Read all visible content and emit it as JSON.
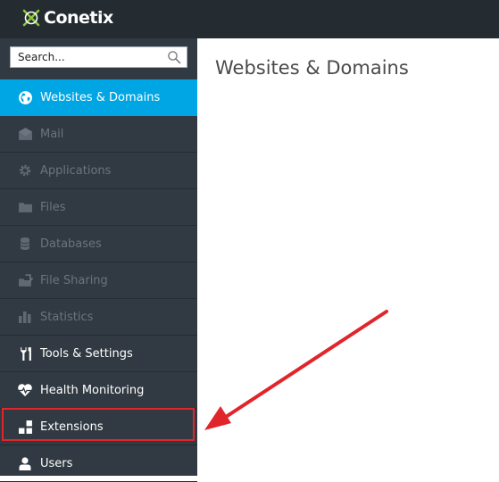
{
  "brand": {
    "name": "Conetix"
  },
  "search": {
    "placeholder": "Search..."
  },
  "sidebar": {
    "items": [
      {
        "label": "Websites & Domains",
        "icon": "globe-icon",
        "state": "active"
      },
      {
        "label": "Mail",
        "icon": "envelope-icon",
        "state": "disabled"
      },
      {
        "label": "Applications",
        "icon": "gear-icon",
        "state": "disabled"
      },
      {
        "label": "Files",
        "icon": "folder-icon",
        "state": "disabled"
      },
      {
        "label": "Databases",
        "icon": "database-icon",
        "state": "disabled"
      },
      {
        "label": "File Sharing",
        "icon": "file-sharing-icon",
        "state": "disabled"
      },
      {
        "label": "Statistics",
        "icon": "bar-chart-icon",
        "state": "disabled"
      },
      {
        "label": "Tools & Settings",
        "icon": "tools-icon",
        "state": "normal"
      },
      {
        "label": "Health Monitoring",
        "icon": "heart-pulse-icon",
        "state": "normal"
      },
      {
        "label": "Extensions",
        "icon": "puzzle-blocks-icon",
        "state": "highlighted"
      },
      {
        "label": "Users",
        "icon": "user-icon",
        "state": "normal"
      }
    ]
  },
  "main": {
    "title": "Websites & Domains"
  },
  "colors": {
    "topbar": "#242b31",
    "sidebar": "#313a42",
    "active": "#00a6e4",
    "disabled_text": "#6a747d",
    "highlight": "#e0262b"
  }
}
